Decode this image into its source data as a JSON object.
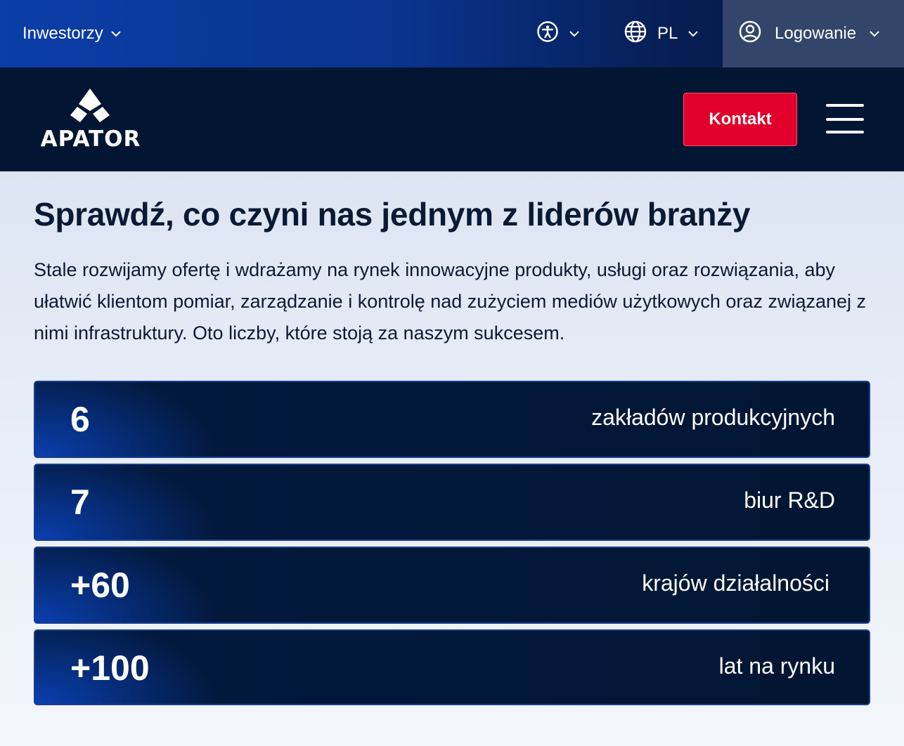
{
  "topbar": {
    "investors_label": "Inwestorzy",
    "language_label": "PL",
    "login_label": "Logowanie",
    "icons": [
      "accessibility-icon",
      "globe-icon",
      "user-icon",
      "chevron-down-icon"
    ]
  },
  "navbar": {
    "brand": "APATOR",
    "contact_label": "Kontakt"
  },
  "main": {
    "headline": "Sprawdź, co czyni nas jednym z liderów branży",
    "intro": "Stale rozwijamy ofertę i wdrażamy na rynek innowacyjne produkty, usługi oraz rozwiązania, aby ułatwić klientom pomiar, zarządzanie i kontrolę nad zużyciem mediów użytkowych oraz związanej z nimi infrastruktury. Oto liczby, które stoją za naszym sukcesem.",
    "stats": [
      {
        "value": "6",
        "label": "zakładów produkcyjnych"
      },
      {
        "value": "7",
        "label": "biur R&D"
      },
      {
        "value": "+60",
        "label": "krajów działalności"
      },
      {
        "value": "+100",
        "label": "lat na rynku"
      }
    ]
  },
  "colors": {
    "accent_red": "#e0002a",
    "navy": "#021633",
    "brand_blue": "#0a3ea8"
  }
}
